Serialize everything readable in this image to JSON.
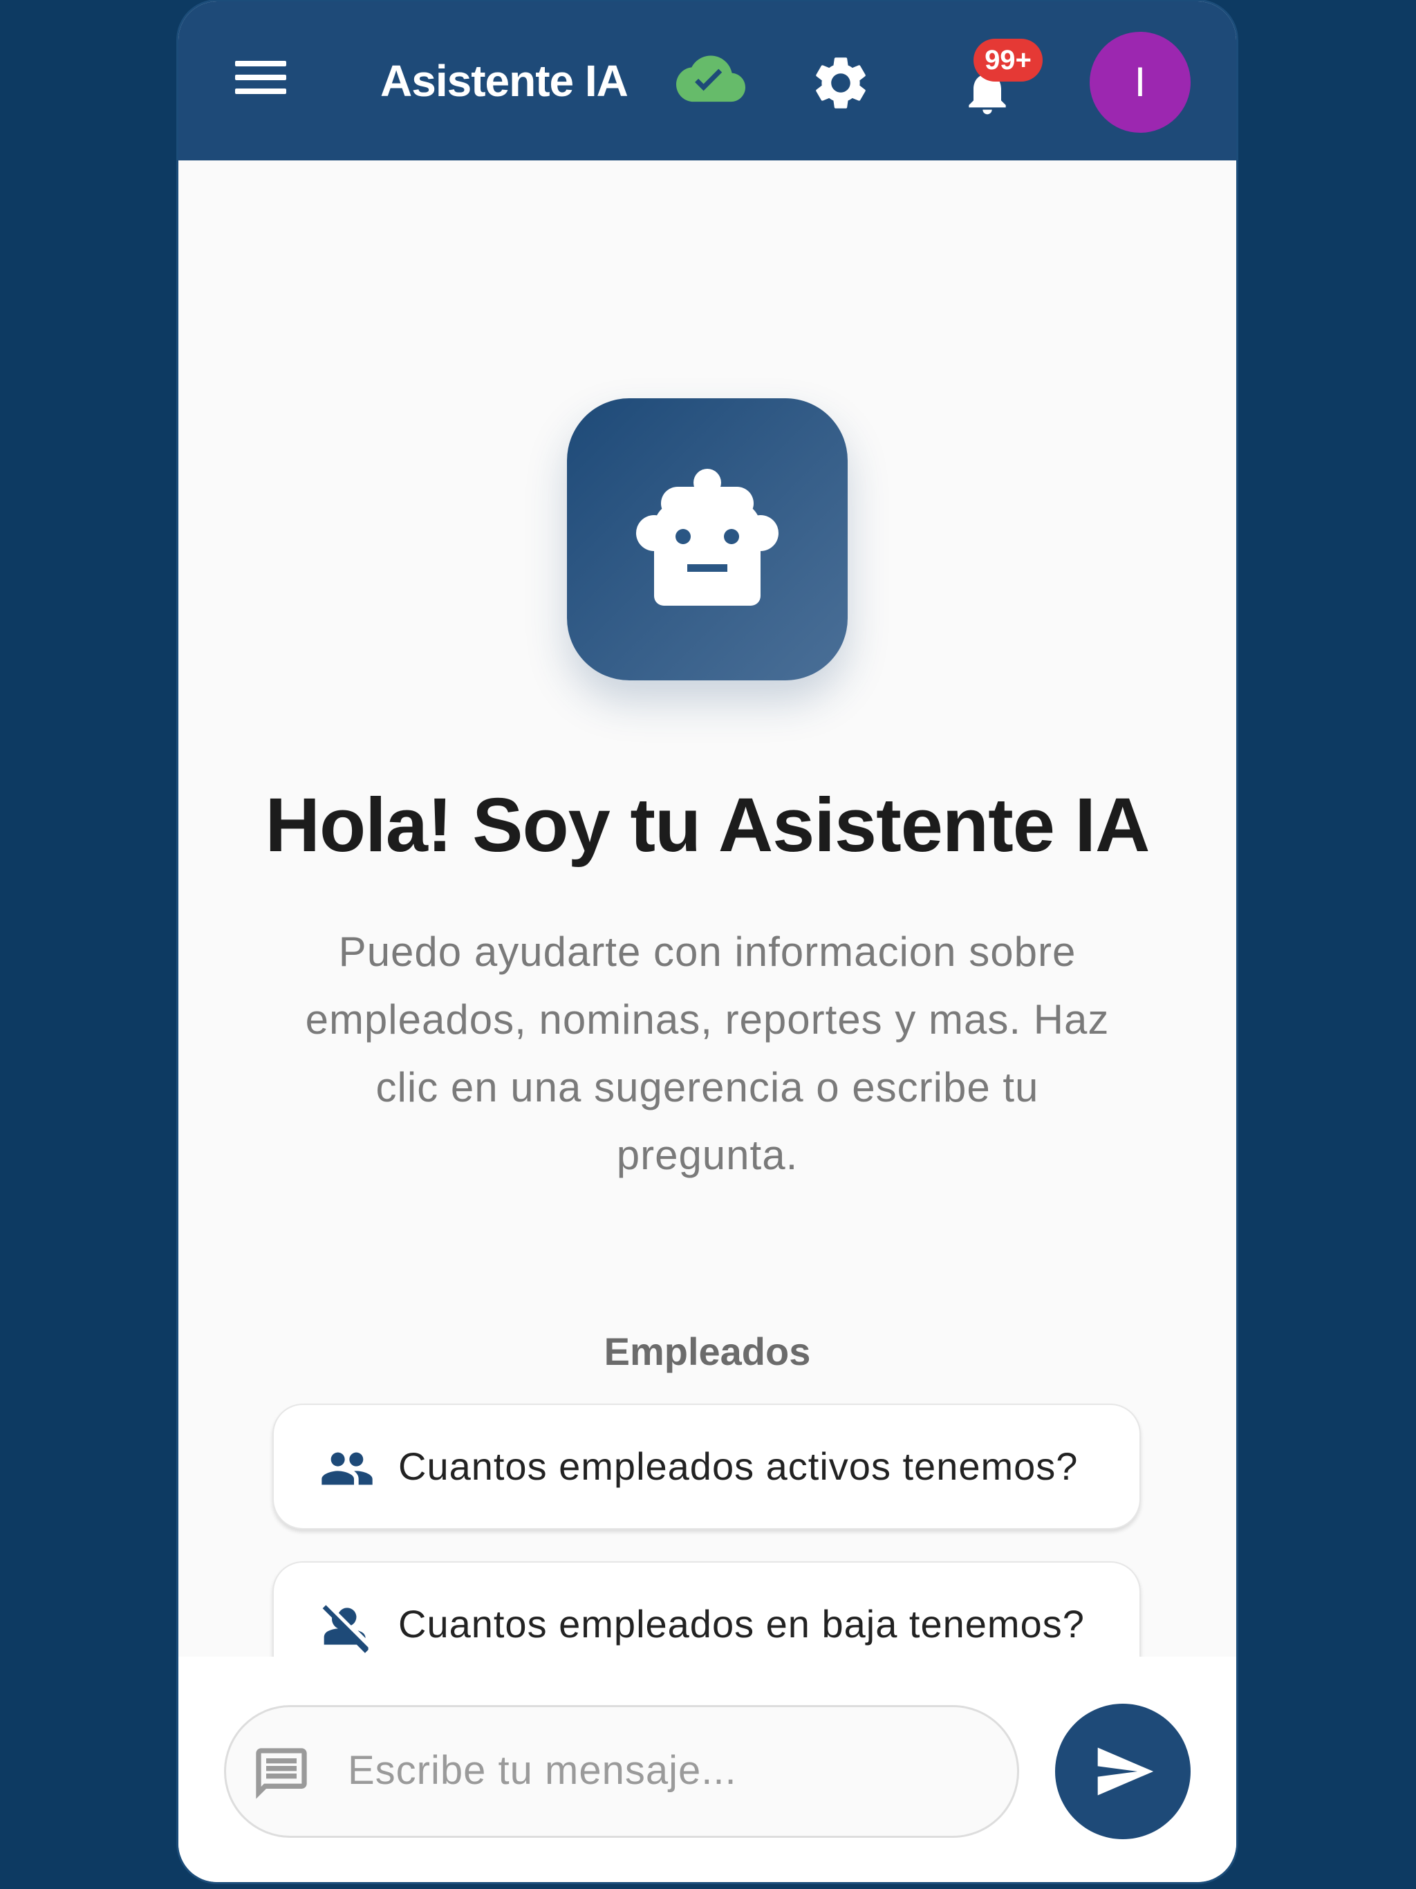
{
  "appbar": {
    "title": "Asistente IA",
    "notification_badge": "99+",
    "avatar_initial": "I",
    "icons": [
      "menu-icon",
      "cloud-done-icon",
      "gear-icon",
      "bell-icon"
    ]
  },
  "hero": {
    "icon": "robot-icon",
    "title": "Hola! Soy tu Asistente IA",
    "subtitle": "Puedo ayudarte con informacion sobre empleados, nominas, reportes y mas. Haz clic en una sugerencia o escribe tu pregunta."
  },
  "suggestions": {
    "section_title": "Empleados",
    "items": [
      {
        "icon": "people-icon",
        "label": "Cuantos empleados activos tenemos?"
      },
      {
        "icon": "person-off-icon",
        "label": "Cuantos empleados en baja tenemos?"
      }
    ]
  },
  "composer": {
    "placeholder": "Escribe tu mensaje...",
    "icons": [
      "chat-icon",
      "send-icon"
    ]
  },
  "colors": {
    "primary": "#1e4a78",
    "background": "#0d3a62",
    "surface": "#fafafa",
    "cloud_ok": "#66bb6a",
    "badge": "#e53935",
    "avatar": "#9c27b0"
  }
}
